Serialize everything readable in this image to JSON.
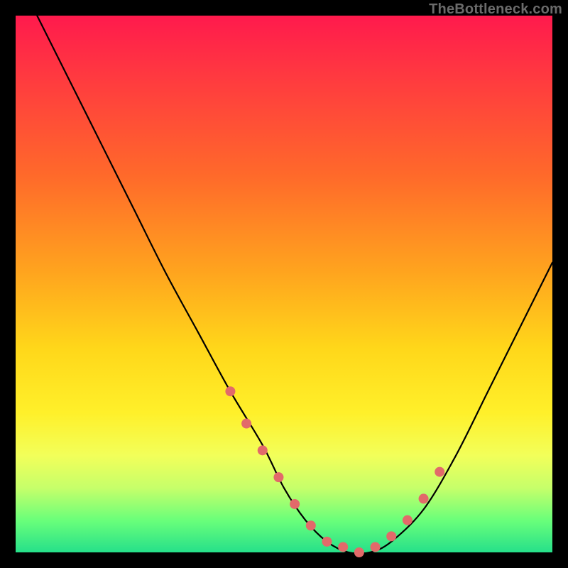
{
  "watermark": "TheBottleneck.com",
  "chart_data": {
    "type": "line",
    "title": "",
    "xlabel": "",
    "ylabel": "",
    "xlim": [
      0,
      100
    ],
    "ylim": [
      0,
      100
    ],
    "series": [
      {
        "name": "bottleneck-curve",
        "x": [
          4,
          10,
          16,
          22,
          28,
          34,
          40,
          46,
          50,
          54,
          58,
          62,
          66,
          70,
          76,
          82,
          88,
          94,
          100
        ],
        "values": [
          100,
          88,
          76,
          64,
          52,
          41,
          30,
          20,
          12,
          6,
          2,
          0,
          0,
          2,
          8,
          18,
          30,
          42,
          54
        ]
      }
    ],
    "markers": {
      "name": "highlight-dots",
      "x": [
        40,
        43,
        46,
        49,
        52,
        55,
        58,
        61,
        64,
        67,
        70,
        73,
        76,
        79
      ],
      "values": [
        30,
        24,
        19,
        14,
        9,
        5,
        2,
        1,
        0,
        1,
        3,
        6,
        10,
        15
      ],
      "color": "#e26a6a"
    },
    "background_gradient": {
      "top": "#ff1a4d",
      "bottom": "#26e08a"
    }
  }
}
